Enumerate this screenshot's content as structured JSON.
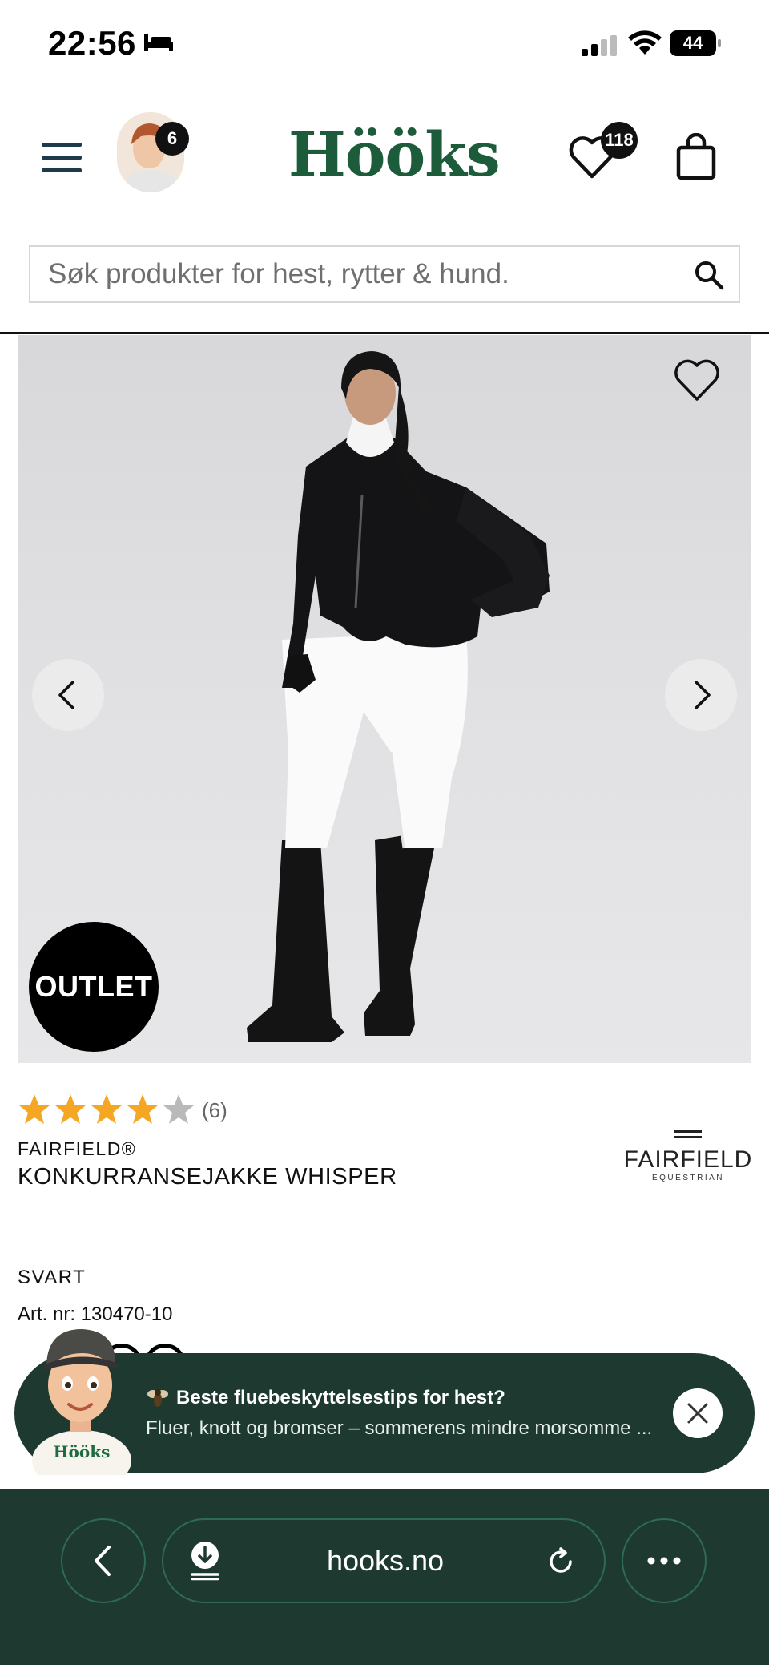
{
  "status_bar": {
    "time": "22:56",
    "battery": "44"
  },
  "header": {
    "logo": "Hööks",
    "avatar_badge": "6",
    "wishlist_count": "118"
  },
  "search": {
    "placeholder": "Søk produkter for hest, rytter & hund."
  },
  "product": {
    "badge": "OUTLET",
    "rating": 4,
    "rating_max": 5,
    "rating_count": "(6)",
    "brand": "FAIRFIELD®",
    "name": "KONKURRANSEJAKKE WHISPER",
    "brand_logo_word": "FAIRFIELD",
    "brand_logo_sub": "EQUESTRIAN",
    "color": "SVART",
    "article_number": "Art. nr: 130470-10"
  },
  "toast": {
    "title": "Beste fluebeskyttelsestips for hest?",
    "text": "Fluer, knott og bromser – sommerens mindre morsomme ...",
    "mascot_text": "Hööks"
  },
  "browser": {
    "url": "hooks.no"
  },
  "colors": {
    "brand_green": "#1d5c3a",
    "dark_green": "#1e3a30",
    "star": "#f5a623"
  }
}
